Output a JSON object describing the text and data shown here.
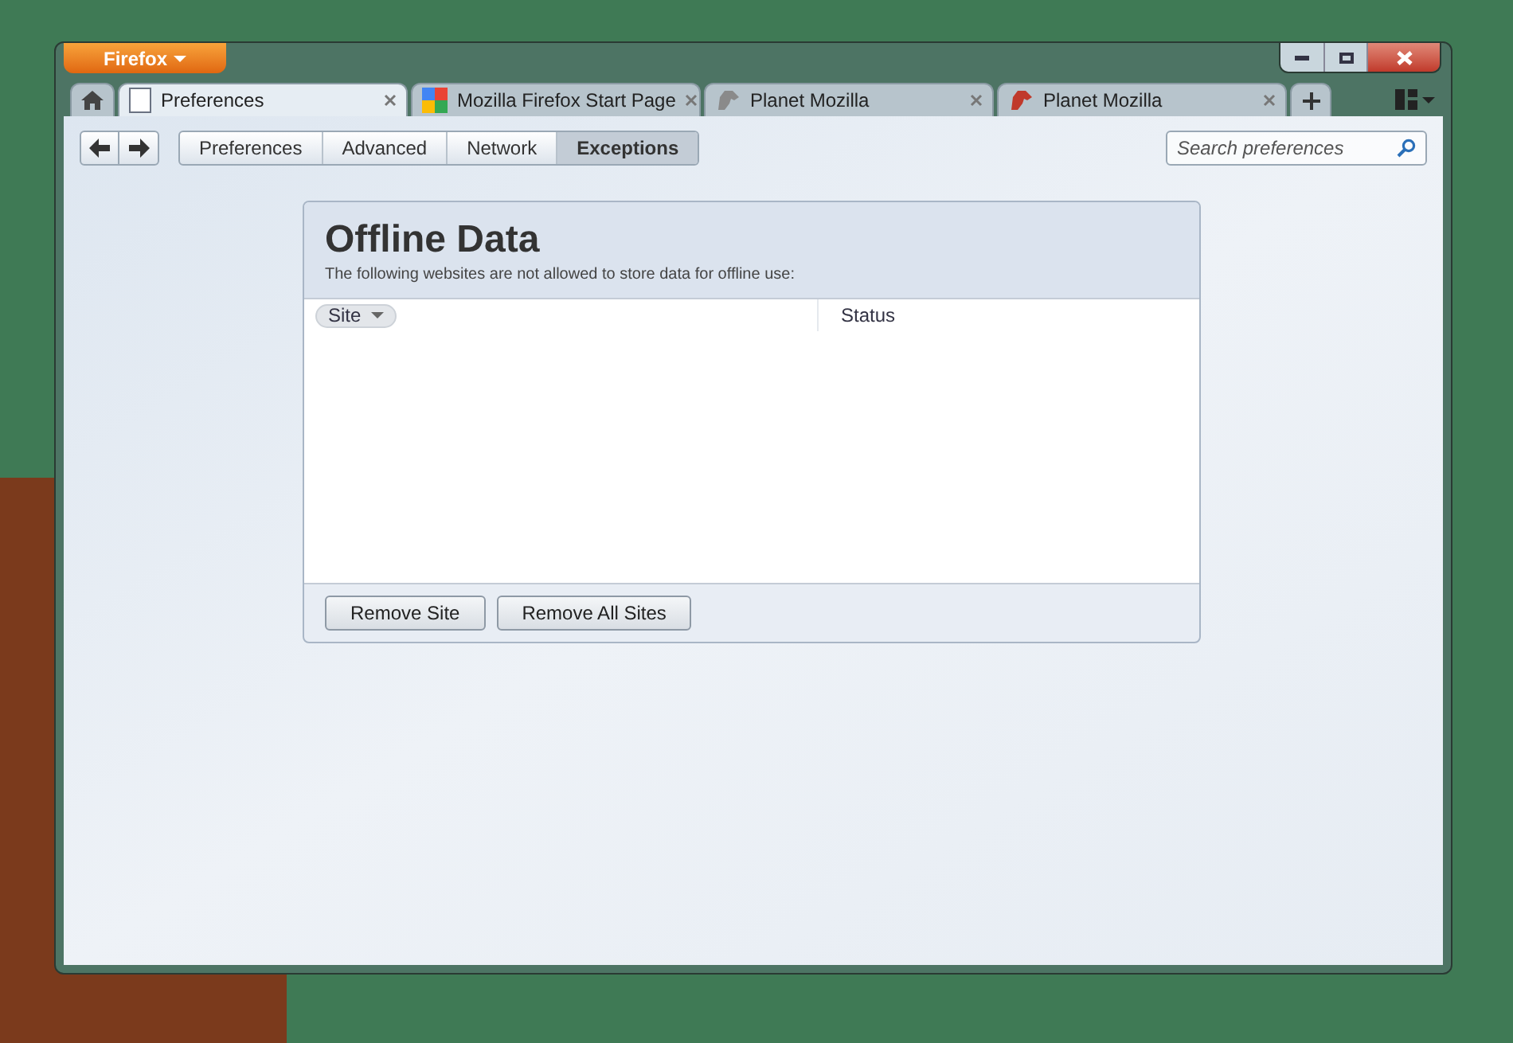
{
  "app_menu": {
    "label": "Firefox"
  },
  "tabs": [
    {
      "kind": "home",
      "selected": false
    },
    {
      "kind": "page",
      "label": "Preferences",
      "selected": true
    },
    {
      "kind": "page",
      "label": "Mozilla Firefox Start Page",
      "selected": false
    },
    {
      "kind": "page",
      "label": "Planet Mozilla",
      "selected": false
    },
    {
      "kind": "page",
      "label": "Planet Mozilla",
      "selected": false
    }
  ],
  "breadcrumbs": [
    {
      "label": "Preferences",
      "selected": false
    },
    {
      "label": "Advanced",
      "selected": false
    },
    {
      "label": "Network",
      "selected": false
    },
    {
      "label": "Exceptions",
      "selected": true
    }
  ],
  "search": {
    "placeholder": "Search preferences"
  },
  "panel": {
    "title": "Offline Data",
    "description": "The following websites are not allowed to store data for offline use:",
    "columns": [
      {
        "label": "Site",
        "sorted": true
      },
      {
        "label": "Status",
        "sorted": false
      }
    ],
    "buttons": [
      "Remove Site",
      "Remove All Sites"
    ]
  }
}
